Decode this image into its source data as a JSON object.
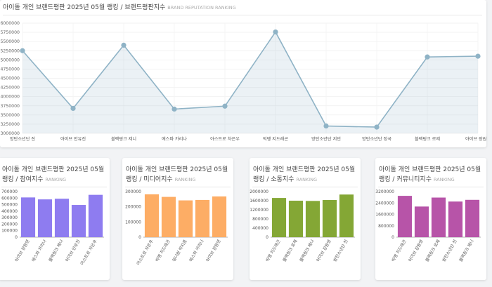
{
  "main": {
    "title": "아이돌 개인 브랜드평판 2025년 05월 랭킹 / 브랜드평판지수",
    "subtitle": "BRAND REPUTATION RANKING"
  },
  "small_cards": [
    {
      "title": "아이돌 개인 브랜드평판 2025년 05월 랭킹 / 참여지수",
      "subtitle": "RANKING"
    },
    {
      "title": "아이돌 개인 브랜드평판 2025년 05월 랭킹 / 미디어지수",
      "subtitle": "RANKING"
    },
    {
      "title": "아이돌 개인 브랜드평판 2025년 05월 랭킹 / 소통지수",
      "subtitle": "RANKING"
    },
    {
      "title": "아이돌 개인 브랜드평판 2025년 05월 랭킹 / 커뮤니티지수",
      "subtitle": "RANKING"
    }
  ],
  "chart_data": [
    {
      "type": "line",
      "categories": [
        "방탄소년단 진",
        "아이브 안유진",
        "블랙핑크 제니",
        "에스파 카리나",
        "아스트로 차은우",
        "빅뱅 지드래곤",
        "방탄소년단 지민",
        "방탄소년단 정국",
        "블랙핑크 로제",
        "아이브 장원영"
      ],
      "values": [
        5250000,
        3680000,
        5400000,
        3660000,
        3740000,
        5760000,
        3200000,
        3170000,
        5080000,
        5100000
      ],
      "ylim": [
        3000000,
        6000000
      ],
      "yticks": [
        "3000000",
        "3250000",
        "3500000",
        "3750000",
        "4000000",
        "4250000",
        "4500000",
        "4750000",
        "5000000",
        "5250000",
        "5500000",
        "5750000",
        "6000000"
      ],
      "grid": true,
      "color": "#8fb3c6"
    },
    {
      "type": "bar",
      "categories": [
        "아이브 장원영",
        "에스파 카리나",
        "블랙핑크 제니",
        "아이브 안유진",
        "아스트로 차은우"
      ],
      "values": [
        610000,
        580000,
        590000,
        495000,
        650000
      ],
      "ylim": [
        0,
        700000
      ],
      "yticks": [
        "0",
        "100000",
        "200000",
        "300000",
        "400000",
        "500000",
        "600000",
        "700000"
      ],
      "color": "#8e7cf0"
    },
    {
      "type": "bar",
      "categories": [
        "아스트로 차은우",
        "빅뱅 지드래곤",
        "워너원 박지훈",
        "에스파 카리나",
        "아이브 장원영"
      ],
      "values": [
        282000,
        265000,
        242000,
        245000,
        268000
      ],
      "ylim": [
        0,
        300000
      ],
      "yticks": [
        "0",
        "100000",
        "200000",
        "300000"
      ],
      "color": "#fdad65"
    },
    {
      "type": "bar",
      "categories": [
        "빅뱅 지드래곤",
        "블랙핑크 로제",
        "블랙핑크 제니",
        "아이브 장원영",
        "방탄소년단 진"
      ],
      "values": [
        1720000,
        1600000,
        1590000,
        1630000,
        1870000
      ],
      "ylim": [
        0,
        2000000
      ],
      "yticks": [
        "0",
        "400000",
        "800000",
        "1200000",
        "1600000",
        "2000000"
      ],
      "color": "#84a735"
    },
    {
      "type": "bar",
      "categories": [
        "빅뱅 지드래곤",
        "아이브 장원영",
        "블랙핑크 로제",
        "방탄소년단 진",
        "블랙핑크 제니"
      ],
      "values": [
        2900000,
        2150000,
        2780000,
        2500000,
        2620000
      ],
      "ylim": [
        0,
        3200000
      ],
      "yticks": [
        "0",
        "800000",
        "1600000",
        "2400000",
        "3200000"
      ],
      "color": "#b754a8"
    }
  ]
}
